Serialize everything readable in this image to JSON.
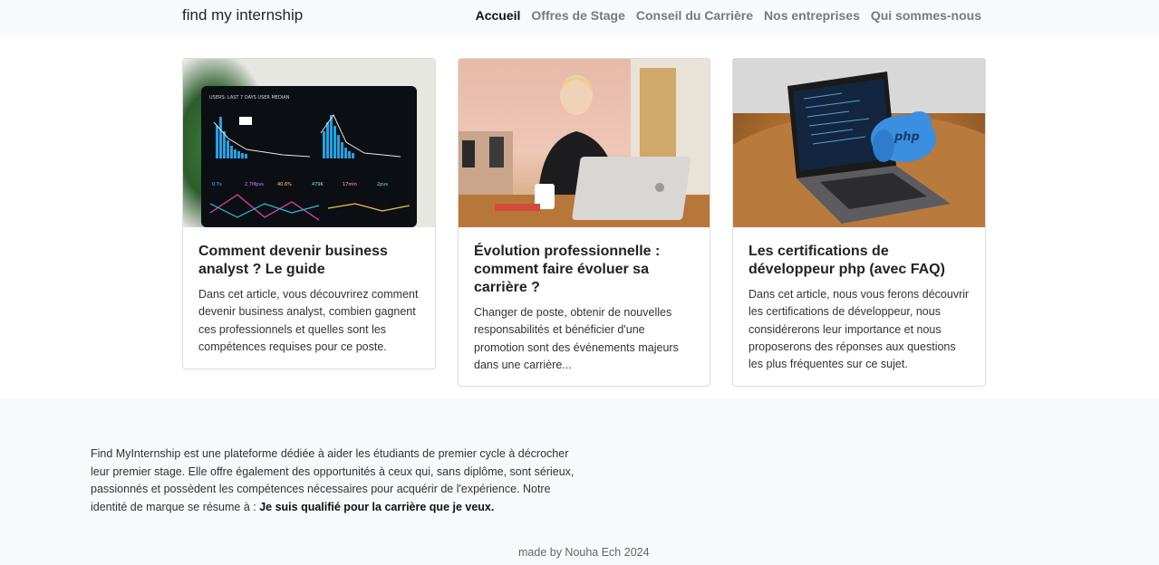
{
  "navbar": {
    "brand": "find my internship",
    "links": [
      {
        "label": "Accueil",
        "active": true
      },
      {
        "label": "Offres de Stage",
        "active": false
      },
      {
        "label": "Conseil du Carrière",
        "active": false
      },
      {
        "label": "Nos entreprises",
        "active": false
      },
      {
        "label": "Qui sommes-nous",
        "active": false
      }
    ]
  },
  "cards": [
    {
      "title": "Comment devenir business analyst ? Le guide",
      "text": "Dans cet article, vous découvrirez comment devenir business analyst, combien gagnent ces professionnels et quelles sont les compétences requises pour ce poste."
    },
    {
      "title": "Évolution professionnelle : comment faire évoluer sa carrière ?",
      "text": "Changer de poste, obtenir de nouvelles responsabilités et bénéficier d'une promotion sont des événements majeurs dans une carrière..."
    },
    {
      "title": "Les certifications de développeur php (avec FAQ)",
      "text": "Dans cet article, nous vous ferons découvrir les certifications de développeur, nous considérerons leur importance et nous proposerons des réponses aux questions les plus fréquentes sur ce sujet."
    }
  ],
  "footer": {
    "about_text": "Find MyInternship est une plateforme dédiée à aider les étudiants de premier cycle à décrocher leur premier stage. Elle offre également des opportunités à ceux qui, sans diplôme, sont sérieux, passionnés et possèdent les compétences nécessaires pour acquérir de l'expérience. Notre identité de marque se résume à : ",
    "about_bold": "Je suis qualifié pour la carrière que je veux.",
    "credit": "made by Nouha Ech 2024"
  },
  "images": {
    "card1_screen_text": "USERS: LAST 7 DAYS USER MEDIAN",
    "card3_sticker": "php"
  }
}
